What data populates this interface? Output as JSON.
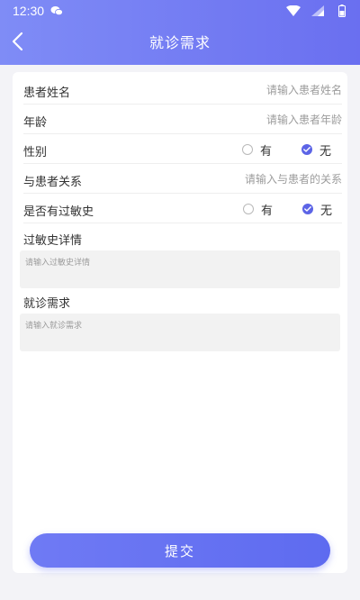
{
  "status_bar": {
    "time": "12:30"
  },
  "header": {
    "title": "就诊需求"
  },
  "form": {
    "patient_name": {
      "label": "患者姓名",
      "placeholder": "请输入患者姓名"
    },
    "age": {
      "label": "年龄",
      "placeholder": "请输入患者年龄"
    },
    "gender": {
      "label": "性别",
      "options": [
        {
          "label": "有",
          "checked": false
        },
        {
          "label": "无",
          "checked": true
        }
      ]
    },
    "relation": {
      "label": "与患者关系",
      "placeholder": "请输入与患者的关系"
    },
    "allergy": {
      "label": "是否有过敏史",
      "options": [
        {
          "label": "有",
          "checked": false
        },
        {
          "label": "无",
          "checked": true
        }
      ]
    },
    "allergy_detail": {
      "label": "过敏史详情",
      "placeholder": "请输入过敏史详情"
    },
    "visit_need": {
      "label": "就诊需求",
      "placeholder": "请输入就诊需求"
    }
  },
  "submit": {
    "label": "提交"
  },
  "colors": {
    "header_start": "#7f8cf6",
    "header_end": "#6a6ff0",
    "accent": "#5c64e6"
  }
}
